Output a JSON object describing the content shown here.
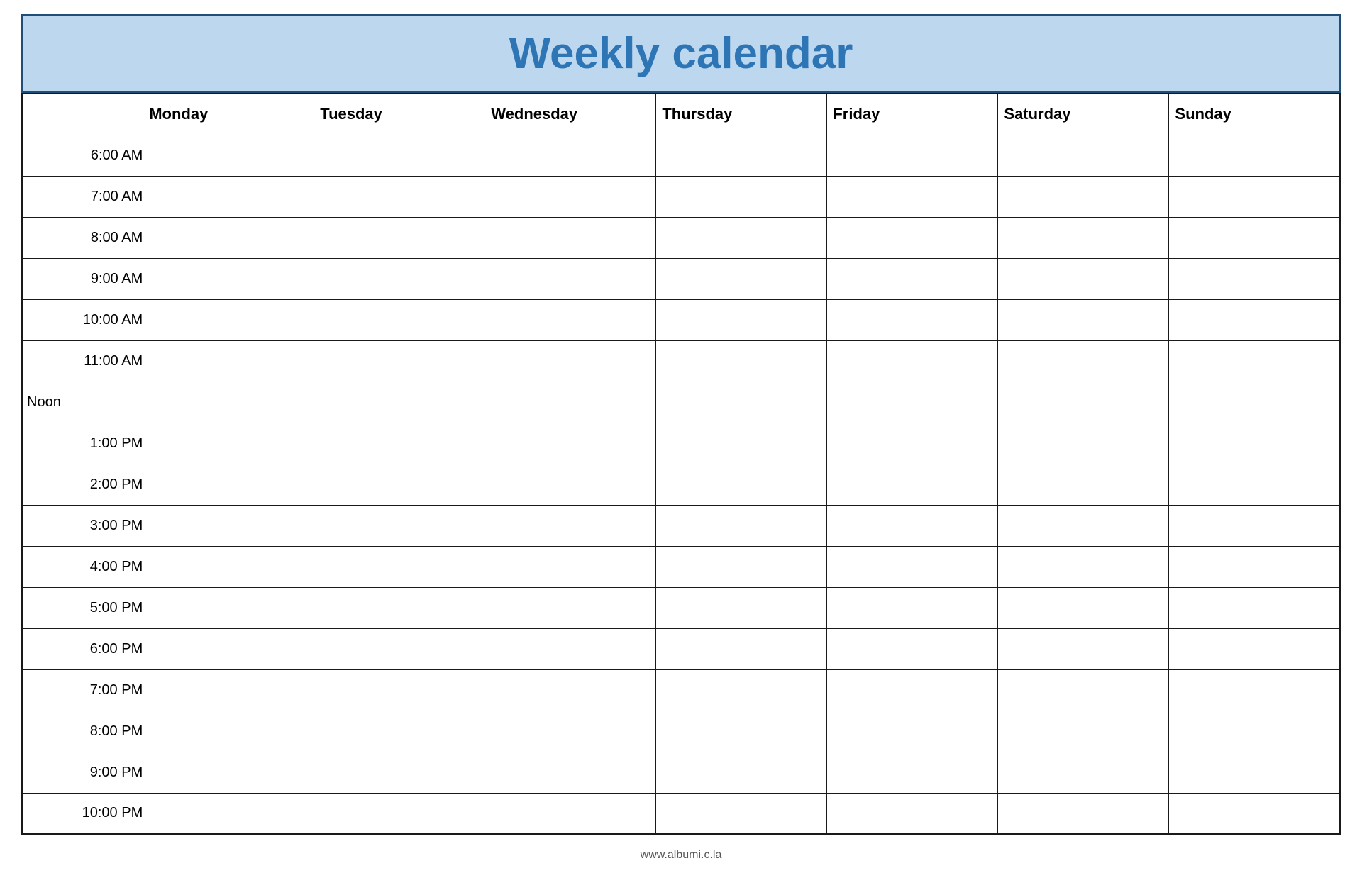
{
  "header": {
    "title": "Weekly calendar",
    "background_color": "#bdd7ee",
    "title_color": "#2e75b6"
  },
  "columns": {
    "time_header": "",
    "days": [
      "Monday",
      "Tuesday",
      "Wednesday",
      "Thursday",
      "Friday",
      "Saturday",
      "Sunday"
    ]
  },
  "time_slots": [
    "6:00 AM",
    "7:00 AM",
    "8:00 AM",
    "9:00 AM",
    "10:00 AM",
    "11:00 AM",
    "Noon",
    "1:00 PM",
    "2:00 PM",
    "3:00 PM",
    "4:00 PM",
    "5:00 PM",
    "6:00 PM",
    "7:00 PM",
    "8:00 PM",
    "9:00 PM",
    "10:00 PM"
  ],
  "footer": {
    "text": "www.albumi.c.la"
  }
}
